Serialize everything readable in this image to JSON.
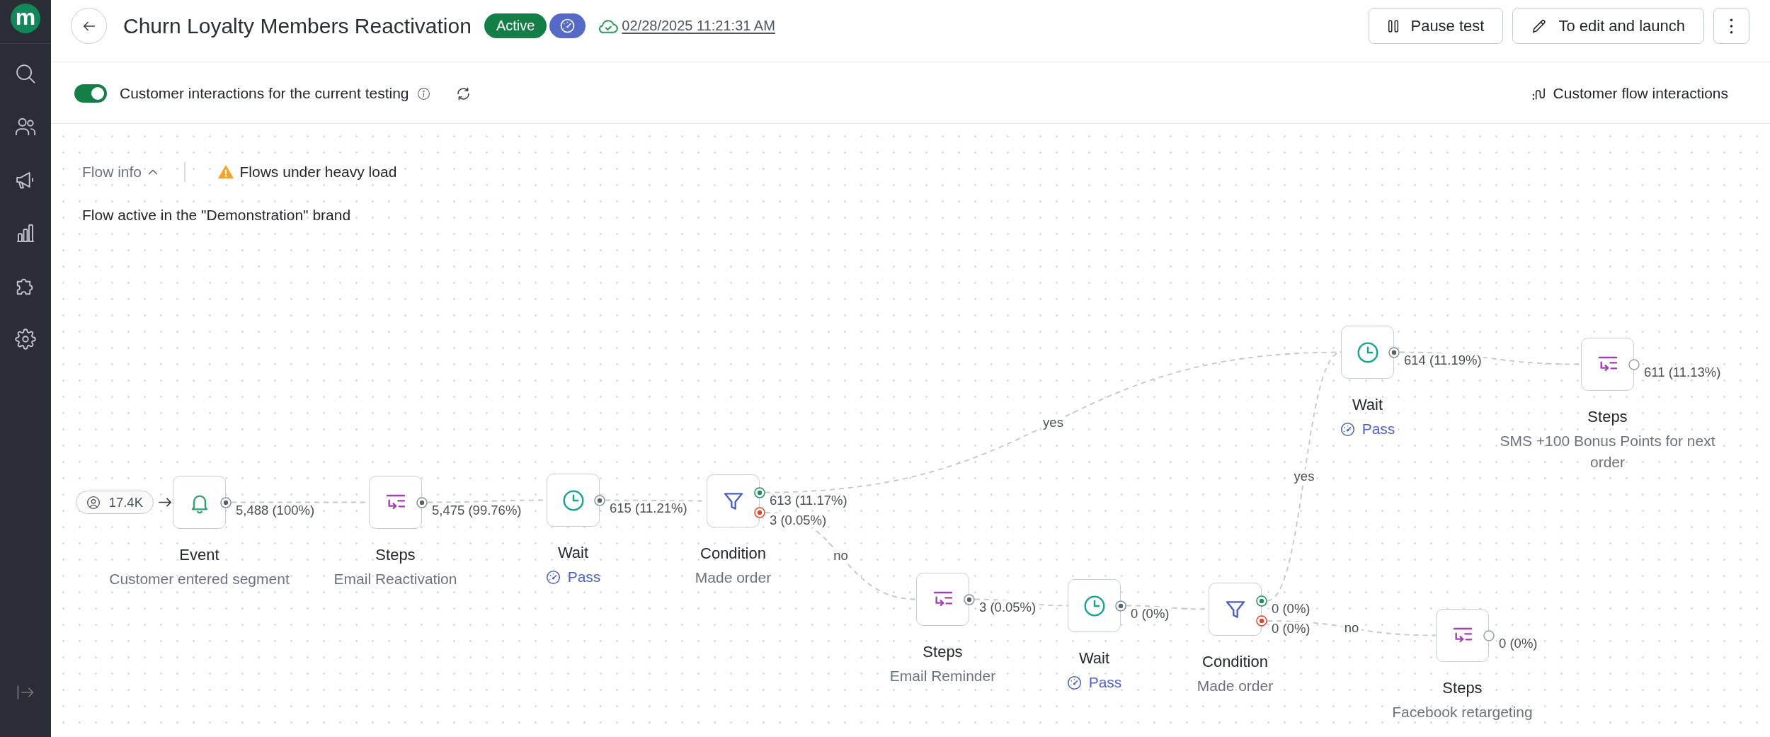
{
  "sidebar": {
    "logo": "m"
  },
  "header": {
    "title": "Churn Loyalty Members Reactivation",
    "status": "Active",
    "saved_at": "02/28/2025 11:21:31 AM",
    "buttons": [
      {
        "kind": "pause",
        "label": "Pause test"
      },
      {
        "kind": "edit",
        "label": "To edit and launch"
      },
      {
        "kind": "more"
      }
    ]
  },
  "toolbar": {
    "toggle": {
      "label": "Customer interactions for the current testing",
      "on": true
    },
    "link": "Customer flow interactions"
  },
  "flow_info": {
    "label": "Flow info",
    "expanded": true,
    "warning": "Flows under heavy load",
    "note": "Flow active in the \"Demonstration\" brand"
  },
  "flow": {
    "audience": "17.4K",
    "nodes": [
      {
        "kind": "event",
        "title": "Event",
        "subtitle": "Customer entered segment",
        "outputs": [
          {
            "kind": "next",
            "count": "5,488 (100%)"
          }
        ]
      },
      {
        "kind": "steps",
        "title": "Steps",
        "subtitle": "Email Reactivation",
        "outputs": [
          {
            "kind": "next",
            "count": "5,475 (99.76%)"
          }
        ]
      },
      {
        "kind": "wait",
        "title": "Wait",
        "status": "Pass",
        "outputs": [
          {
            "kind": "next",
            "count": "615 (11.21%)"
          }
        ]
      },
      {
        "kind": "condition",
        "title": "Condition",
        "subtitle": "Made order",
        "outputs": [
          {
            "kind": "yes",
            "count": "613 (11.17%)",
            "branch": "yes"
          },
          {
            "kind": "no",
            "count": "3 (0.05%)",
            "branch": "no"
          }
        ]
      },
      {
        "kind": "wait",
        "title": "Wait",
        "status": "Pass",
        "outputs": [
          {
            "kind": "next",
            "count": "614 (11.19%)"
          }
        ]
      },
      {
        "kind": "steps",
        "title": "Steps",
        "subtitle": "SMS +100 Bonus Points for next order",
        "outputs": [
          {
            "kind": "end",
            "count": "611 (11.13%)"
          }
        ]
      },
      {
        "kind": "steps",
        "title": "Steps",
        "subtitle": "Email Reminder",
        "outputs": [
          {
            "kind": "next",
            "count": "3 (0.05%)"
          }
        ]
      },
      {
        "kind": "wait",
        "title": "Wait",
        "status": "Pass",
        "outputs": [
          {
            "kind": "next",
            "count": "0 (0%)"
          }
        ]
      },
      {
        "kind": "condition",
        "title": "Condition",
        "subtitle": "Made order",
        "outputs": [
          {
            "kind": "yes",
            "count": "0 (0%)",
            "branch": "yes"
          },
          {
            "kind": "no",
            "count": "0 (0%)",
            "branch": "no"
          }
        ]
      },
      {
        "kind": "steps",
        "title": "Steps",
        "subtitle": "Facebook retargeting",
        "outputs": [
          {
            "kind": "end",
            "count": "0 (0%)"
          }
        ]
      }
    ]
  }
}
